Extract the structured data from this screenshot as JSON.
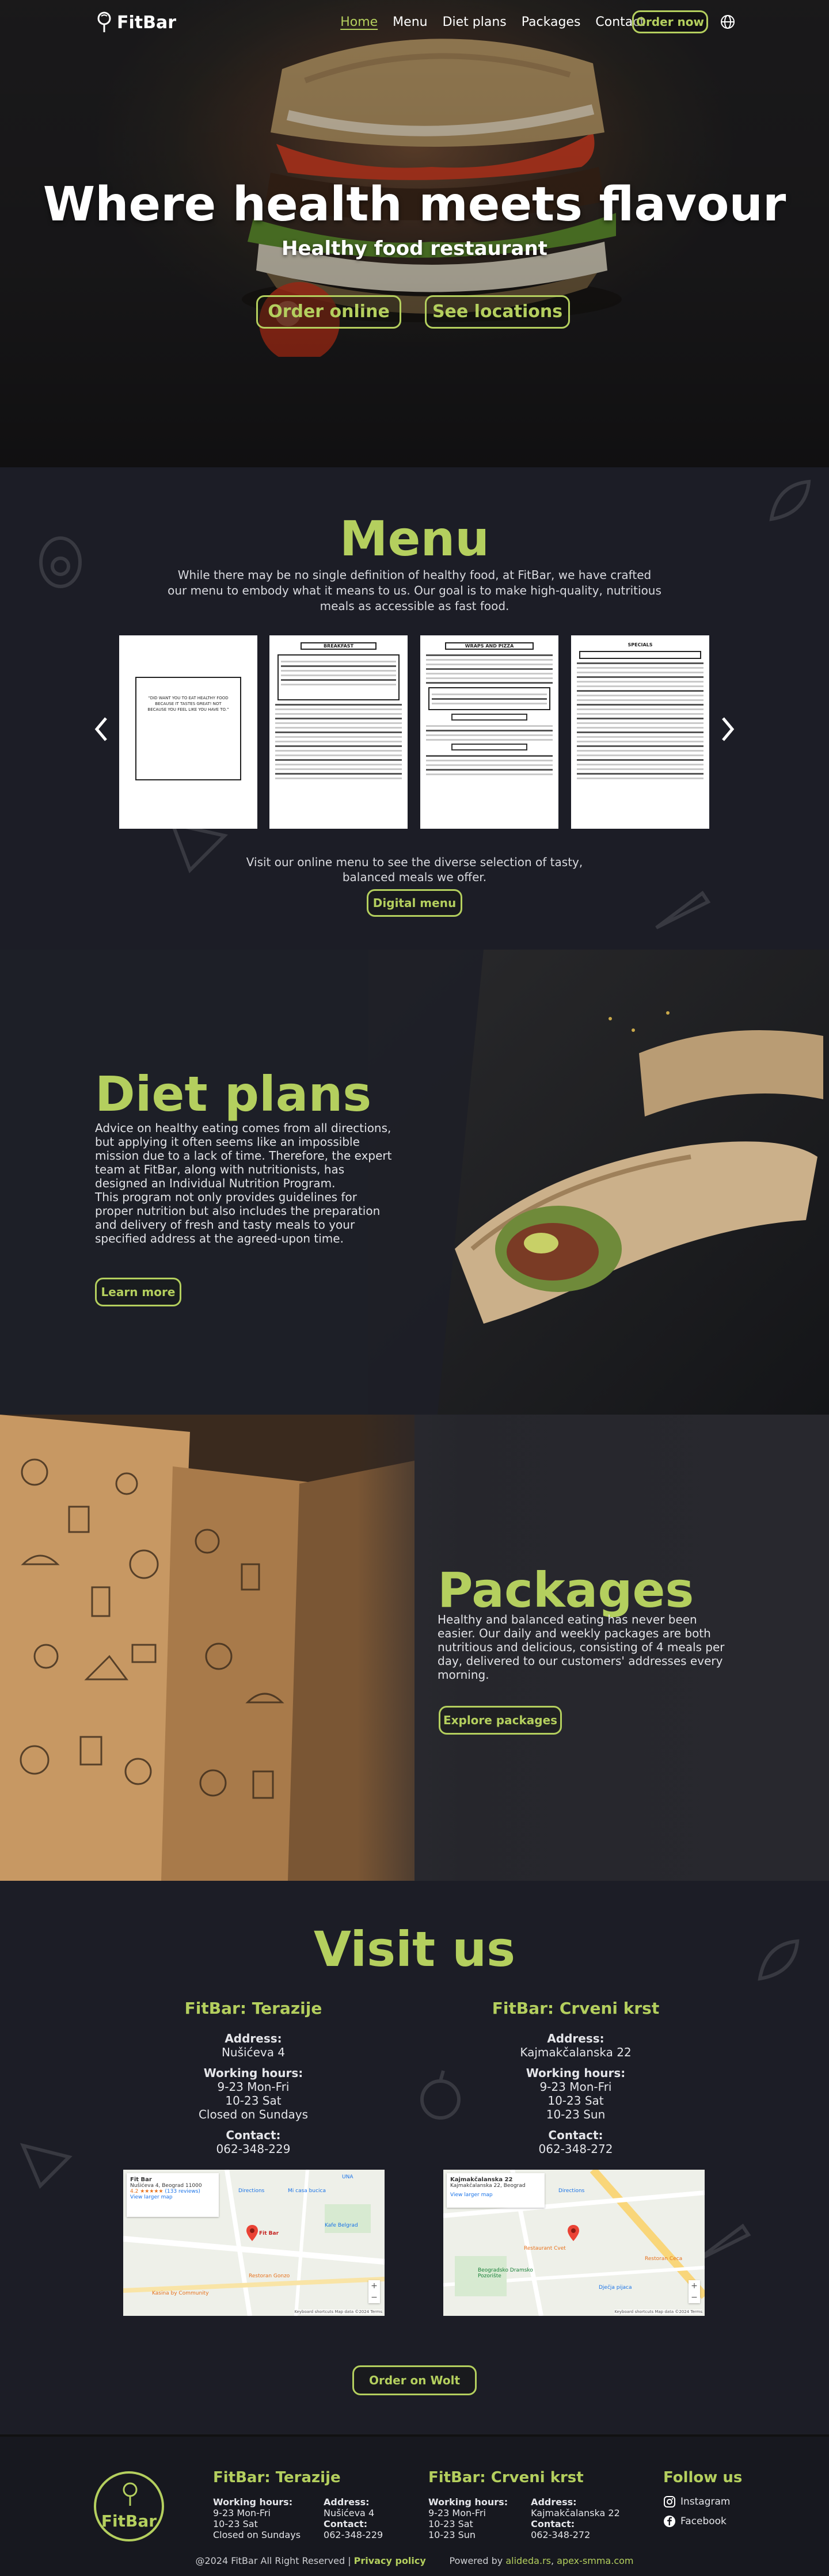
{
  "nav": {
    "logo": "FitBar",
    "links": [
      "Home",
      "Menu",
      "Diet plans",
      "Packages",
      "Contact"
    ],
    "order_button": "Order now"
  },
  "hero": {
    "title": "Where health meets flavour",
    "subtitle": "Healthy food restaurant",
    "order_button": "Order online",
    "locations_button": "See locations"
  },
  "menu": {
    "title": "Menu",
    "description": "While there may be no single definition of healthy food, at FitBar, we have crafted our menu to embody what it means to us. Our goal is to make high-quality, nutritious meals as accessible as fast food.",
    "cards": [
      {
        "heading": "",
        "quote": "“DID WANT YOU TO EAT HEALTHY FOOD BECAUSE IT TASTES GREAT! NOT BECAUSE YOU FEEL LIKE YOU HAVE TO.”"
      },
      {
        "heading": "BREAKFAST"
      },
      {
        "heading": "WRAPS AND PIZZA"
      },
      {
        "heading": "SPECIALS"
      }
    ],
    "cta_text": "Visit our online menu to see the diverse selection of tasty, balanced meals we offer.",
    "digital_button": "Digital menu"
  },
  "diet": {
    "title": "Diet plans",
    "text": "Advice on healthy eating comes from all directions, but applying it often seems like an impossible mission due to a lack of time. Therefore, the expert team at FitBar, along with nutritionists, has designed an Individual Nutrition Program.\nThis program not only provides guidelines for proper nutrition but also includes the preparation and delivery of fresh and tasty meals to your specified address at the agreed-upon time.",
    "button": "Learn more"
  },
  "packages": {
    "title": "Packages",
    "text": "Healthy and balanced eating has never been easier. Our daily and weekly packages are both nutritious and delicious, consisting of 4 meals per day, delivered to our customers' addresses every morning.",
    "button": "Explore packages"
  },
  "visit": {
    "title": "Visit us",
    "locations": [
      {
        "name": "FitBar: Terazije",
        "address_label": "Address:",
        "address": "Nušićeva 4",
        "hours_label": "Working hours:",
        "hours": [
          "9-23 Mon-Fri",
          "10-23 Sat",
          "Closed on Sundays"
        ],
        "contact_label": "Contact:",
        "phone": "062-348-229",
        "map": {
          "place": "Fit Bar",
          "addr": "Nušićeva 4, Beograd 11000",
          "rating": "4.2",
          "reviews": "(133 reviews)",
          "link": "View larger map",
          "directions": "Directions",
          "labels": [
            "Mi casa bucica",
            "UNA",
            "Kafe Belgrad",
            "Restoran Gonzo",
            "Kasina by Community"
          ],
          "footer": "Keyboard shortcuts  Map data ©2024  Terms"
        }
      },
      {
        "name": "FitBar: Crveni krst",
        "address_label": "Address:",
        "address": "Kajmakčalanska 22",
        "hours_label": "Working hours:",
        "hours": [
          "9-23 Mon-Fri",
          "10-23 Sat",
          "10-23 Sun"
        ],
        "contact_label": "Contact:",
        "phone": "062-348-272",
        "map": {
          "place": "Kajmakčalanska 22",
          "addr": "Kajmakčalanska 22, Beograd",
          "link": "View larger map",
          "directions": "Directions",
          "labels": [
            "Restaurant Cvet",
            "Beogradsko Dramsko Pozorište",
            "Dječja pijaca",
            "Restoran Ceca"
          ],
          "footer": "Keyboard shortcuts  Map data ©2024  Terms"
        }
      }
    ],
    "wolt_button": "Order on Wolt"
  },
  "footer": {
    "logo": "FitBar",
    "locations": [
      {
        "name": "FitBar: Terazije",
        "hours_label": "Working hours:",
        "hours": [
          "9-23 Mon-Fri",
          "10-23 Sat",
          "Closed on Sundays"
        ],
        "address_label": "Address:",
        "address": "Nušićeva 4",
        "contact_label": "Contact:",
        "phone": "062-348-229"
      },
      {
        "name": "FitBar: Crveni krst",
        "hours_label": "Working hours:",
        "hours": [
          "9-23 Mon-Fri",
          "10-23 Sat",
          "10-23 Sun"
        ],
        "address_label": "Address:",
        "address": "Kajmakčalanska 22",
        "contact_label": "Contact:",
        "phone": "062-348-272"
      }
    ],
    "follow_title": "Follow us",
    "social": [
      "Instagram",
      "Facebook"
    ],
    "copyright": "@2024 FitBar All Right Reserved |",
    "privacy": "Privacy policy",
    "powered": "Powered by",
    "powered_links": [
      "alideda.rs",
      "apex-smma.com"
    ]
  },
  "colors": {
    "accent": "#b4cf5e",
    "background": "#1c1d26"
  },
  "icons": [
    "fitbar-logo-icon",
    "globe-icon",
    "chevron-left-icon",
    "chevron-right-icon",
    "instagram-icon",
    "facebook-icon",
    "map-pin-icon"
  ]
}
